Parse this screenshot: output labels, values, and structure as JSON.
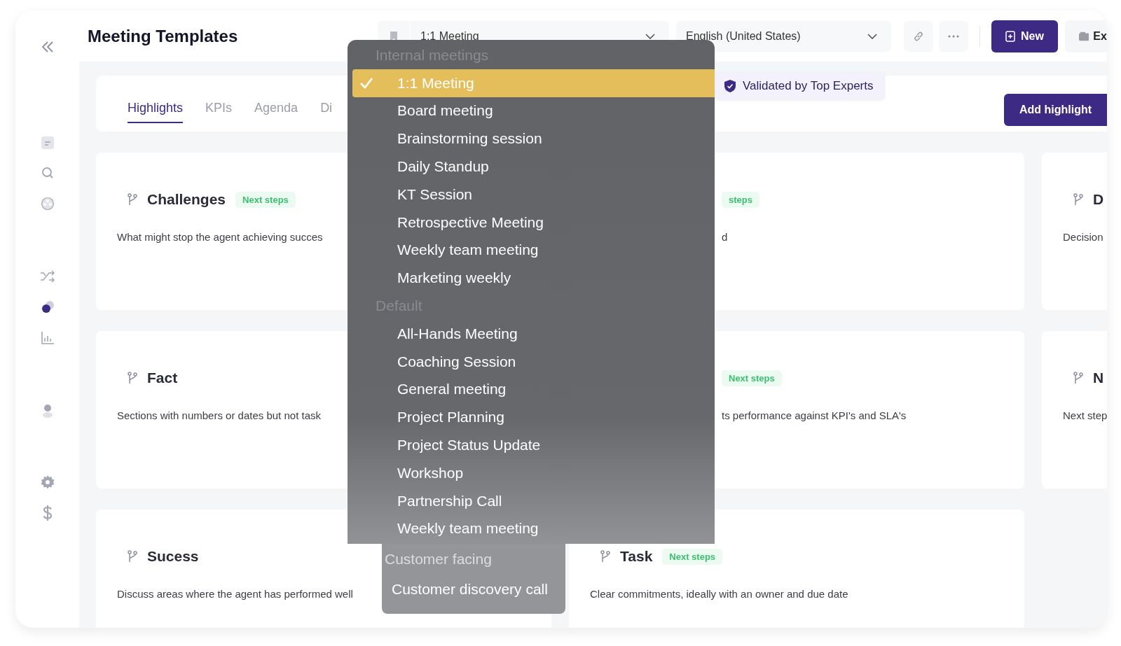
{
  "header": {
    "title": "Meeting Templates"
  },
  "template_select": {
    "value": "1:1 Meeting"
  },
  "language_select": {
    "value": "English (United States)"
  },
  "new_button": {
    "label": "New"
  },
  "export_button": {
    "label": "Ex"
  },
  "sidebar": {
    "items": [
      {
        "kind": "document",
        "selected": false
      },
      {
        "kind": "search",
        "selected": false
      },
      {
        "kind": "reel",
        "selected": false
      },
      {
        "kind": "shuffle",
        "selected": false
      },
      {
        "kind": "circles",
        "selected": true
      },
      {
        "kind": "chart",
        "selected": false
      },
      {
        "kind": "person",
        "selected": false
      },
      {
        "kind": "settings",
        "selected": false
      },
      {
        "kind": "dollar",
        "selected": false
      }
    ]
  },
  "tabs": [
    {
      "label": "Highlights",
      "selected": true
    },
    {
      "label": "KPIs",
      "selected": false
    },
    {
      "label": "Agenda",
      "selected": false
    },
    {
      "label": "Di",
      "selected": false
    }
  ],
  "validated_badge": {
    "label": "Validated by Top Experts"
  },
  "add_button": {
    "label": "Add highlight"
  },
  "cards": [
    {
      "title": "Challenges",
      "tag": "Next steps",
      "description": "What might stop the agent achieving succes"
    },
    {
      "tag": "steps",
      "description": "d"
    },
    {
      "title": "D",
      "description": "Decision"
    },
    {
      "title": "Fact",
      "description": "Sections with numbers or dates but not task"
    },
    {
      "tag": "Next steps",
      "description": "ts performance against KPI's and SLA's"
    },
    {
      "title": "N",
      "description": "Next step"
    },
    {
      "title": "Sucess",
      "description": "Discuss areas where the agent has performed well"
    },
    {
      "title": "Task",
      "tag": "Next steps",
      "description": "Clear commitments, ideally with an owner and due date"
    }
  ],
  "menu": {
    "groups": [
      {
        "label": "Internal meetings",
        "items": [
          {
            "label": "1:1 Meeting",
            "selected": true
          },
          {
            "label": "Board meeting",
            "selected": false
          },
          {
            "label": "Brainstorming session",
            "selected": false
          },
          {
            "label": "Daily Standup",
            "selected": false
          },
          {
            "label": "KT Session",
            "selected": false
          },
          {
            "label": "Retrospective Meeting",
            "selected": false
          },
          {
            "label": "Weekly team meeting",
            "selected": false
          },
          {
            "label": "Marketing weekly",
            "selected": false
          }
        ]
      },
      {
        "label": "Default",
        "items": [
          {
            "label": "All-Hands Meeting",
            "selected": false
          },
          {
            "label": "Coaching Session",
            "selected": false
          },
          {
            "label": "General meeting",
            "selected": false
          },
          {
            "label": "Project Planning",
            "selected": false
          },
          {
            "label": "Project Status Update",
            "selected": false
          },
          {
            "label": "Workshop",
            "selected": false
          },
          {
            "label": "Partnership Call",
            "selected": false
          },
          {
            "label": "Weekly team meeting",
            "selected": false
          }
        ]
      },
      {
        "label": "Customer facing",
        "items": [
          {
            "label": "Customer discovery call",
            "selected": false
          }
        ]
      }
    ]
  }
}
